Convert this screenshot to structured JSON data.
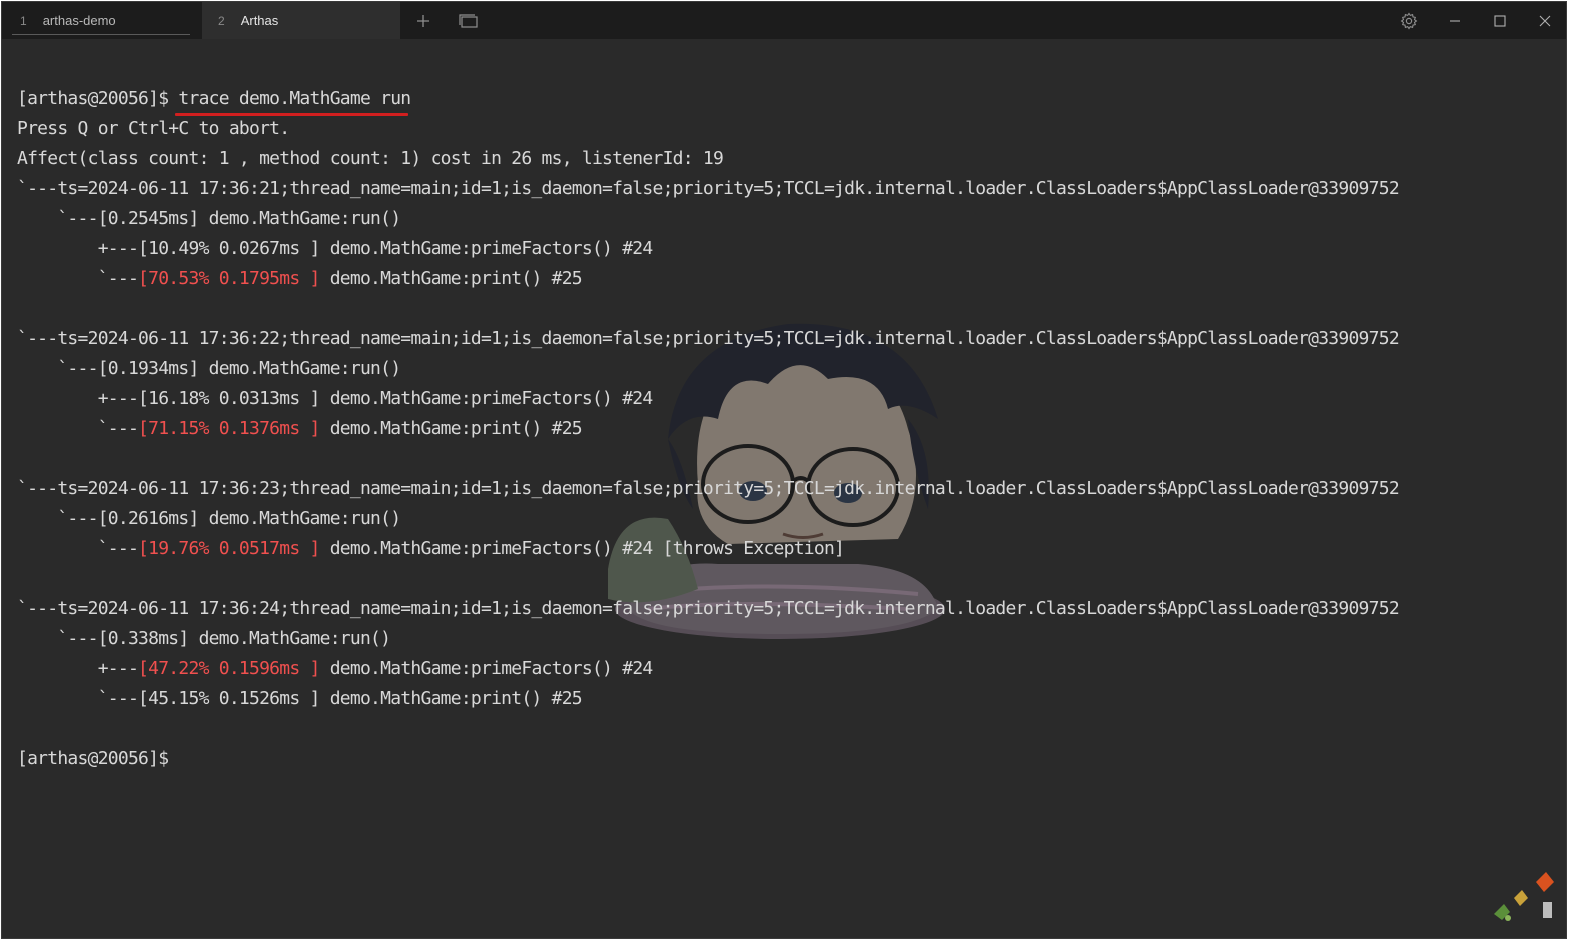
{
  "tabs": [
    {
      "number": "1",
      "title": "arthas-demo",
      "active": false
    },
    {
      "number": "2",
      "title": "Arthas",
      "active": true
    }
  ],
  "titlebar_icons": {
    "new_tab": "plus-icon",
    "tab_switcher": "tab-switcher-icon",
    "settings": "gear-icon",
    "minimize": "minimize-icon",
    "maximize": "maximize-icon",
    "close": "close-icon"
  },
  "colors": {
    "background": "#2a2a2a",
    "text": "#d8d8d8",
    "highlight": "#f0504f",
    "underline": "#d21f1f"
  },
  "terminal": {
    "prompt": "[arthas@20056]$ ",
    "command": "trace demo.MathGame run",
    "abort_hint": "Press Q or Ctrl+C to abort.",
    "affect": "Affect(class count: 1 , method count: 1) cost in 26 ms, listenerId: 19",
    "trace1": {
      "ts": "`---ts=2024-06-11 17:36:21;thread_name=main;id=1;is_daemon=false;priority=5;TCCL=jdk.internal.loader.ClassLoaders$AppClassLoader@33909752",
      "root": "    `---[0.2545ms] demo.MathGame:run()",
      "c1_prefix": "        +---[10.49% 0.0267ms ] demo.MathGame:primeFactors() #24",
      "c2_prefix": "        `---",
      "c2_hot": "[70.53% 0.1795ms ]",
      "c2_rest": " demo.MathGame:print() #25"
    },
    "trace2": {
      "ts": "`---ts=2024-06-11 17:36:22;thread_name=main;id=1;is_daemon=false;priority=5;TCCL=jdk.internal.loader.ClassLoaders$AppClassLoader@33909752",
      "root": "    `---[0.1934ms] demo.MathGame:run()",
      "c1_prefix": "        +---[16.18% 0.0313ms ] demo.MathGame:primeFactors() #24",
      "c2_prefix": "        `---",
      "c2_hot": "[71.15% 0.1376ms ]",
      "c2_rest": " demo.MathGame:print() #25"
    },
    "trace3": {
      "ts": "`---ts=2024-06-11 17:36:23;thread_name=main;id=1;is_daemon=false;priority=5;TCCL=jdk.internal.loader.ClassLoaders$AppClassLoader@33909752",
      "root": "    `---[0.2616ms] demo.MathGame:run()",
      "c1_prefix": "        `---",
      "c1_hot": "[19.76% 0.0517ms ]",
      "c1_rest": " demo.MathGame:primeFactors() #24 [throws Exception]"
    },
    "trace4": {
      "ts": "`---ts=2024-06-11 17:36:24;thread_name=main;id=1;is_daemon=false;priority=5;TCCL=jdk.internal.loader.ClassLoaders$AppClassLoader@33909752",
      "root": "    `---[0.338ms] demo.MathGame:run()",
      "c1_prefix": "        +---",
      "c1_hot": "[47.22% 0.1596ms ]",
      "c1_rest": " demo.MathGame:primeFactors() #24",
      "c2_prefix": "        `---[45.15% 0.1526ms ] demo.MathGame:print() #25"
    },
    "final_prompt": "[arthas@20056]$"
  }
}
